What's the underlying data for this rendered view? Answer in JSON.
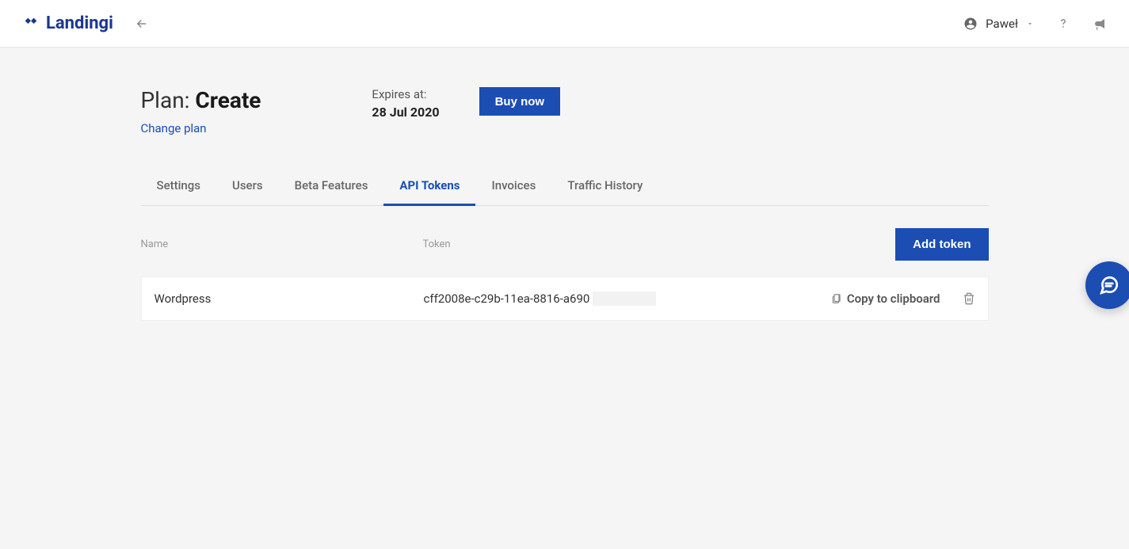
{
  "brand": {
    "name": "Landingi"
  },
  "user": {
    "name": "Paweł"
  },
  "plan": {
    "prefix": "Plan: ",
    "name": "Create",
    "change_label": "Change plan",
    "expires_label": "Expires at:",
    "expires_date": "28 Jul 2020",
    "buy_label": "Buy now"
  },
  "tabs": {
    "settings": "Settings",
    "users": "Users",
    "beta": "Beta Features",
    "api": "API Tokens",
    "invoices": "Invoices",
    "traffic": "Traffic History"
  },
  "table": {
    "header_name": "Name",
    "header_token": "Token",
    "add_label": "Add token",
    "copy_label": "Copy to clipboard"
  },
  "tokens": [
    {
      "name": "Wordpress",
      "value": "cff2008e-c29b-11ea-8816-a690"
    }
  ]
}
